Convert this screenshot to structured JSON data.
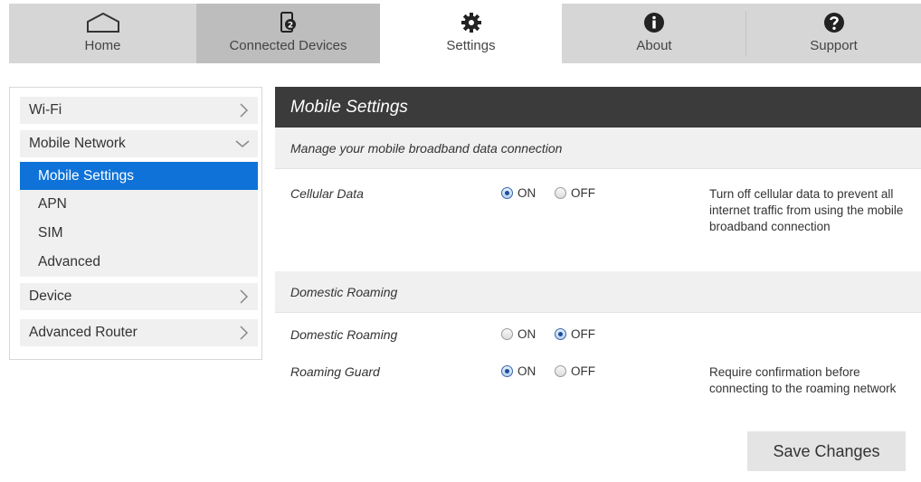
{
  "tabs": [
    {
      "label": "Home",
      "icon": "home-icon"
    },
    {
      "label": "Connected Devices",
      "icon": "device-icon",
      "badge": "2"
    },
    {
      "label": "Settings",
      "icon": "gear-icon"
    },
    {
      "label": "About",
      "icon": "info-icon"
    },
    {
      "label": "Support",
      "icon": "help-icon"
    }
  ],
  "sidebar": {
    "wifi": "Wi-Fi",
    "mobile_network": "Mobile Network",
    "sub": [
      "Mobile Settings",
      "APN",
      "SIM",
      "Advanced"
    ],
    "device": "Device",
    "advanced_router": "Advanced Router"
  },
  "panel": {
    "title": "Mobile Settings",
    "subtitle": "Manage your mobile broadband data connection",
    "cellular_label": "Cellular Data",
    "cellular_desc": "Turn off cellular data to prevent all internet traffic from using the mobile broadband connection",
    "roaming_section": "Domestic Roaming",
    "roaming_label": "Domestic Roaming",
    "guard_label": "Roaming Guard",
    "guard_desc": "Require confirmation before connecting to the roaming network",
    "on": "ON",
    "off": "OFF",
    "save": "Save Changes"
  },
  "state": {
    "cellular_data": "ON",
    "domestic_roaming": "OFF",
    "roaming_guard": "ON"
  },
  "colors": {
    "accent": "#0f72d8",
    "header": "#3b3b3b"
  }
}
